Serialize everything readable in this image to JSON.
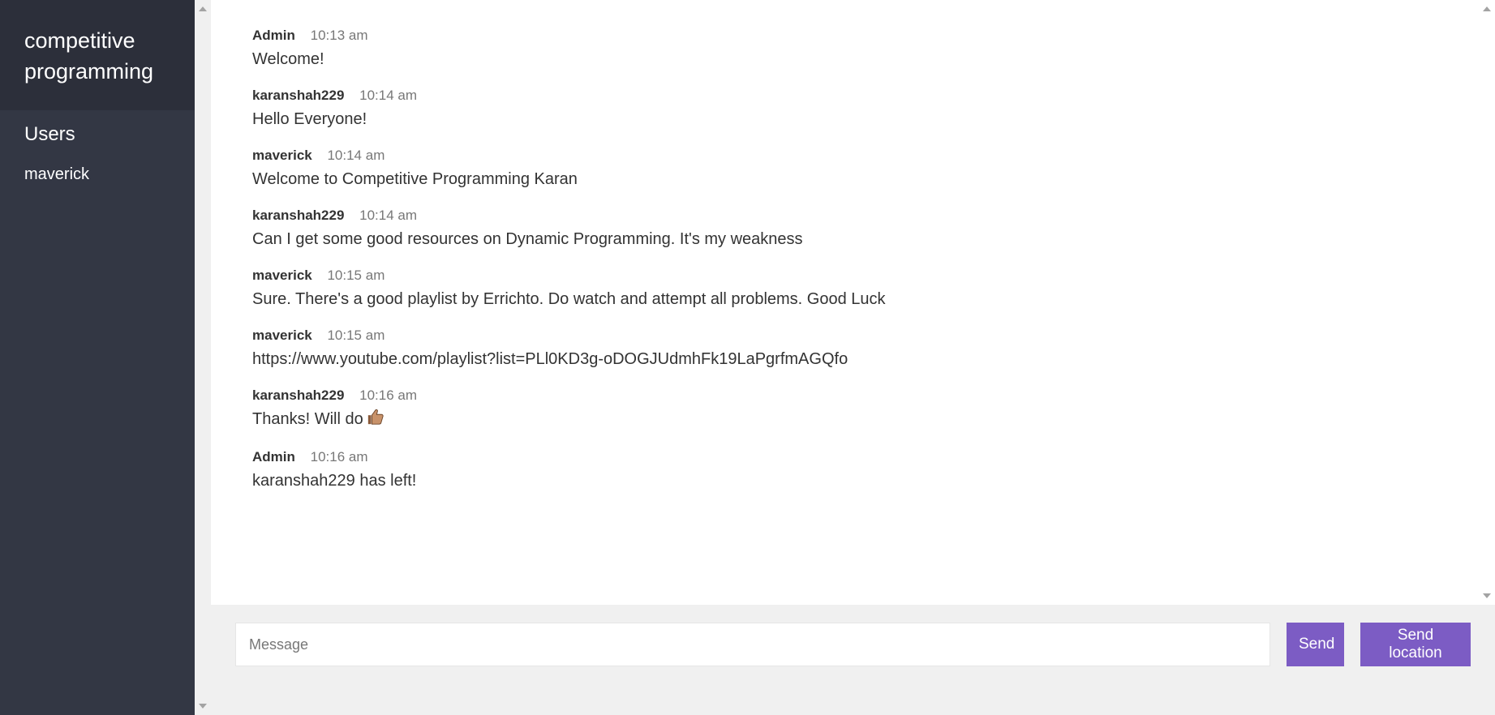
{
  "sidebar": {
    "room_title": "competitive programming",
    "users_heading": "Users",
    "users": [
      "maverick"
    ]
  },
  "messages": [
    {
      "author": "Admin",
      "time": "10:13 am",
      "text": "Welcome!"
    },
    {
      "author": "karanshah229",
      "time": "10:14 am",
      "text": "Hello Everyone!"
    },
    {
      "author": "maverick",
      "time": "10:14 am",
      "text": "Welcome to Competitive Programming Karan"
    },
    {
      "author": "karanshah229",
      "time": "10:14 am",
      "text": "Can I get some good resources on Dynamic Programming. It's my weakness"
    },
    {
      "author": "maverick",
      "time": "10:15 am",
      "text": "Sure. There's a good playlist by Errichto. Do watch and attempt all problems. Good Luck"
    },
    {
      "author": "maverick",
      "time": "10:15 am",
      "text": "https://www.youtube.com/playlist?list=PLl0KD3g-oDOGJUdmhFk19LaPgrfmAGQfo"
    },
    {
      "author": "karanshah229",
      "time": "10:16 am",
      "text": "Thanks! Will do",
      "emoji": "thumbs-up-icon"
    },
    {
      "author": "Admin",
      "time": "10:16 am",
      "text": "karanshah229 has left!"
    }
  ],
  "compose": {
    "placeholder": "Message",
    "value": "",
    "send_label": "Send",
    "send_location_label": "Send location"
  },
  "colors": {
    "sidebar_bg": "#333744",
    "sidebar_header_bg": "#2c2f3a",
    "accent": "#7c5cc4",
    "compose_bg": "#f0f0f0"
  }
}
